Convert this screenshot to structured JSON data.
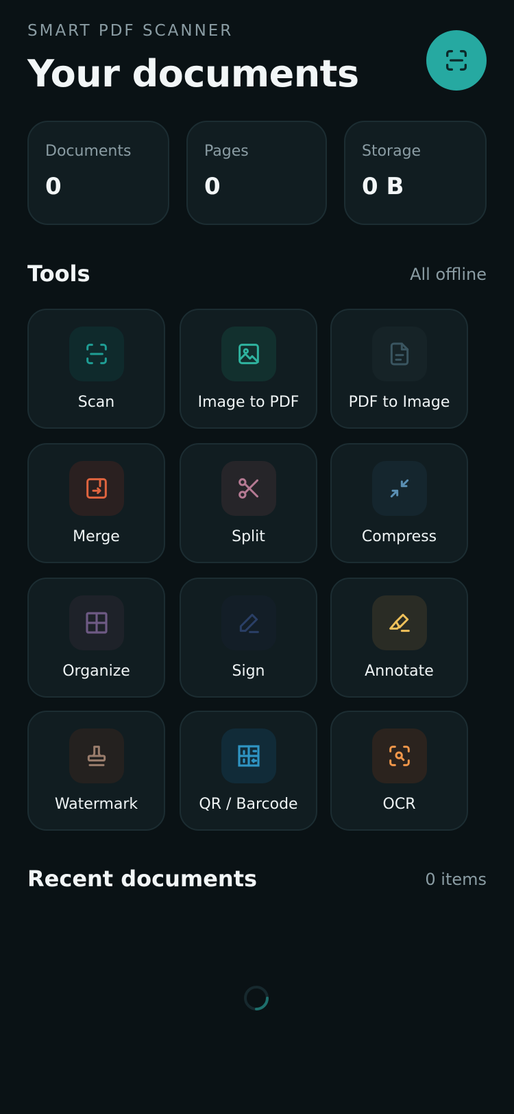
{
  "header": {
    "eyebrow": "SMART PDF SCANNER",
    "title": "Your documents",
    "scan_fab_icon": "scan-frame-icon"
  },
  "stats": [
    {
      "label": "Documents",
      "value": "0"
    },
    {
      "label": "Pages",
      "value": "0"
    },
    {
      "label": "Storage",
      "value": "0 B"
    }
  ],
  "tools_section": {
    "title": "Tools",
    "meta": "All offline",
    "items": [
      {
        "label": "Scan",
        "icon": "scan-frame-icon",
        "color": "#1f9e95"
      },
      {
        "label": "Image to PDF",
        "icon": "image-icon",
        "color": "#2fb39f"
      },
      {
        "label": "PDF to Image",
        "icon": "document-icon",
        "color": "#3a5560"
      },
      {
        "label": "Merge",
        "icon": "merge-icon",
        "color": "#e0643f"
      },
      {
        "label": "Split",
        "icon": "scissors-icon",
        "color": "#b57a93"
      },
      {
        "label": "Compress",
        "icon": "compress-arrows-icon",
        "color": "#5a8fb3"
      },
      {
        "label": "Organize",
        "icon": "grid-icon",
        "color": "#6e5a84"
      },
      {
        "label": "Sign",
        "icon": "pen-icon",
        "color": "#2a3f66"
      },
      {
        "label": "Annotate",
        "icon": "highlighter-icon",
        "color": "#f0c15a"
      },
      {
        "label": "Watermark",
        "icon": "stamp-icon",
        "color": "#9a7d6c"
      },
      {
        "label": "QR / Barcode",
        "icon": "qr-code-icon",
        "color": "#2f95c4"
      },
      {
        "label": "OCR",
        "icon": "text-scan-icon",
        "color": "#f2974a"
      }
    ]
  },
  "recent_section": {
    "title": "Recent documents",
    "meta": "0 items",
    "loading_icon": "loading-spinner-icon"
  },
  "colors": {
    "background": "#0a1215",
    "card": "#111d21",
    "card_border": "#1c2d32",
    "accent": "#26a9a1",
    "muted_text": "#8a9ca3"
  }
}
